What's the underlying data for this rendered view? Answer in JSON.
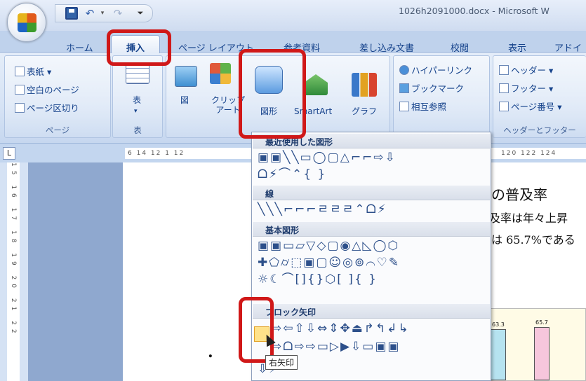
{
  "window": {
    "title": "1026h2091000.docx - Microsoft W"
  },
  "tabs": [
    {
      "label": "ホーム"
    },
    {
      "label": "挿入",
      "active": true
    },
    {
      "label": "ページ レイアウト"
    },
    {
      "label": "参考資料"
    },
    {
      "label": "差し込み文書"
    },
    {
      "label": "校閲"
    },
    {
      "label": "表示"
    },
    {
      "label": "アドイ"
    }
  ],
  "ribbon": {
    "page_group": {
      "items": [
        "表紙 ▾",
        "空白のページ",
        "ページ区切り"
      ],
      "label": "ページ"
    },
    "table_group": {
      "button": "表",
      "label": "表"
    },
    "illustrations": {
      "picture": "図",
      "clipart": "クリップ\nアート",
      "shapes": "図形",
      "smartart": "SmartArt",
      "chart": "グラフ"
    },
    "links": {
      "items": [
        "ハイパーリンク",
        "ブックマーク",
        "相互参照"
      ]
    },
    "header_footer": {
      "items": [
        "ヘッダー ▾",
        "フッター ▾",
        "ページ番号 ▾"
      ],
      "label": "ヘッダーとフッター"
    }
  },
  "ruler": {
    "h_ticks": "6  14  12  1  12",
    "h_ticks_right": "120  122  124",
    "v_ticks": "15  16  17  18  19  20  21  22"
  },
  "shape_panel": {
    "sections": [
      {
        "title": "最近使用した図形",
        "rows": [
          "▣▣╲╲▭◯▢△⌐⌐⇨⇩",
          "ᗝ⚡⌒⌃{ }"
        ]
      },
      {
        "title": "線",
        "rows": [
          "╲╲╲⌐⌐⌐ㄹㄹㄹ⌃ᗝ⚡"
        ]
      },
      {
        "title": "基本図形",
        "rows": [
          "▣▣▭▱▽◇▢◉△◺◯⬡",
          "✚⬠⌭⬚▣▢☺◎⊚⌒♡✎",
          "☼☾⌒[]{}⬡[ ]{ }"
        ]
      },
      {
        "title": "ブロック矢印",
        "rows": [
          "⇨⇦⇧⇩⇔⇕✥⏏↱↰↲↳",
          "⇨ᗝ⇨⇨▭▷▶⇩▭▣▣",
          "⇩⚡"
        ]
      }
    ]
  },
  "tooltip": "右矢印",
  "document": {
    "line1": "の普及率",
    "line2": "及率は年々上昇",
    "line3": "は 65.7%である",
    "bullet": "."
  },
  "chart_data": {
    "type": "bar",
    "values": [
      63.3,
      65.7
    ],
    "labels": [
      "63.3",
      "65.7"
    ],
    "colors": [
      "#b6e3f0",
      "#f6c6dc"
    ]
  }
}
